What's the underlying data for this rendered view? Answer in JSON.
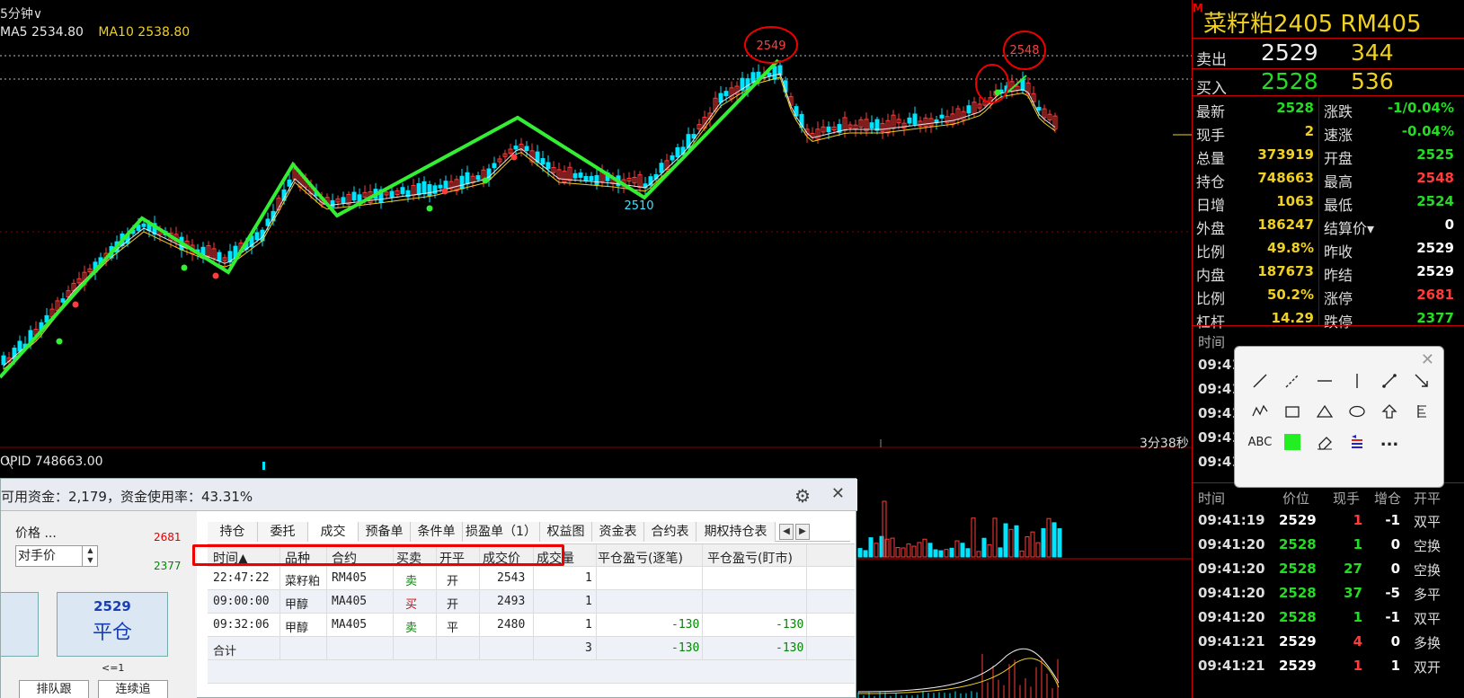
{
  "chart": {
    "period": "5分钟∨",
    "ma5_label": "MA5 2534.80",
    "ma10_label": "MA10 2538.80",
    "timer": "3分38秒",
    "opid_label": "OPID 748663.00",
    "annotations": {
      "peak1": "2549",
      "peak2": "2548",
      "trough": "2510"
    },
    "colors": {
      "up": "#ff3b3b",
      "down": "#00e5ff",
      "trend": "#33ee33",
      "ma5": "#e8e8e8",
      "ma10": "#f0d020"
    }
  },
  "quote": {
    "m_badge": "M",
    "title": "菜籽粕2405  RM405",
    "ask": {
      "label": "卖出",
      "price": "2529",
      "volume": "344"
    },
    "bid": {
      "label": "买入",
      "price": "2528",
      "volume": "536"
    },
    "stats": [
      {
        "l1": "最新",
        "v1": "2528",
        "c1": "#22dd22",
        "l2": "涨跌",
        "v2": "-1/0.04%",
        "c2": "#22dd22"
      },
      {
        "l1": "现手",
        "v1": "2",
        "c1": "#f0d020",
        "l2": "速涨",
        "v2": "-0.04%",
        "c2": "#22dd22"
      },
      {
        "l1": "总量",
        "v1": "373919",
        "c1": "#f0d020",
        "l2": "开盘",
        "v2": "2525",
        "c2": "#22dd22"
      },
      {
        "l1": "持仓",
        "v1": "748663",
        "c1": "#f0d020",
        "l2": "最高",
        "v2": "2548",
        "c2": "#ff3b3b"
      },
      {
        "l1": "日增",
        "v1": "1063",
        "c1": "#f0d020",
        "l2": "最低",
        "v2": "2524",
        "c2": "#22dd22"
      },
      {
        "l1": "外盘",
        "v1": "186247",
        "c1": "#f0d020",
        "l2": "结算价▾",
        "v2": "0",
        "c2": "#ffffff"
      },
      {
        "l1": "比例",
        "v1": "49.8%",
        "c1": "#f0d020",
        "l2": "昨收",
        "v2": "2529",
        "c2": "#ffffff"
      },
      {
        "l1": "内盘",
        "v1": "187673",
        "c1": "#f0d020",
        "l2": "昨结",
        "v2": "2529",
        "c2": "#ffffff"
      },
      {
        "l1": "比例",
        "v1": "50.2%",
        "c1": "#f0d020",
        "l2": "涨停",
        "v2": "2681",
        "c2": "#ff3b3b"
      },
      {
        "l1": "杠杆",
        "v1": "14.29",
        "c1": "#f0d020",
        "l2": "跌停",
        "v2": "2377",
        "c2": "#22dd22"
      }
    ],
    "tape_headers": [
      "时间",
      "价位",
      "现手",
      "增仓",
      "开平"
    ],
    "tape_top": [
      {
        "time": "时间"
      },
      {
        "time": "09:41"
      },
      {
        "time": "09:41"
      },
      {
        "time": "09:41"
      },
      {
        "time": "09:41"
      },
      {
        "time": "09:41"
      }
    ],
    "tape": [
      {
        "time": "09:41:19",
        "px": "2529",
        "pc": "#ffffff",
        "qty": "1",
        "inc": "-1",
        "type": "双平"
      },
      {
        "time": "09:41:20",
        "px": "2528",
        "pc": "#22dd22",
        "qty": "1",
        "inc": "0",
        "type": "空换"
      },
      {
        "time": "09:41:20",
        "px": "2528",
        "pc": "#22dd22",
        "qty": "27",
        "inc": "0",
        "type": "空换"
      },
      {
        "time": "09:41:20",
        "px": "2528",
        "pc": "#22dd22",
        "qty": "37",
        "inc": "-5",
        "type": "多平"
      },
      {
        "time": "09:41:20",
        "px": "2528",
        "pc": "#22dd22",
        "qty": "1",
        "inc": "-1",
        "type": "双平"
      },
      {
        "time": "09:41:21",
        "px": "2529",
        "pc": "#ffffff",
        "qty": "4",
        "inc": "0",
        "type": "多换"
      },
      {
        "time": "09:41:21",
        "px": "2529",
        "pc": "#ffffff",
        "qty": "1",
        "inc": "1",
        "type": "双开"
      }
    ]
  },
  "draw_tools": {
    "close": "✕",
    "icons": [
      "line-icon",
      "ray-icon",
      "hline-icon",
      "vline-icon",
      "segment-icon",
      "arrow-icon",
      "polyline-icon",
      "rect-icon",
      "triangle-icon",
      "ellipse-icon",
      "up-arrow-icon",
      "fib-icon",
      "text-icon",
      "color-icon",
      "eraser-icon",
      "settings-icon",
      "more-icon"
    ],
    "text_tool": "ABC",
    "more": "...",
    "swatch_color": "#22ee22"
  },
  "trade": {
    "funds": "可用资金：2,179，资金使用率：43.31%",
    "price_label": "价格 ...",
    "price_mode": "对手价",
    "limit_up": "2681",
    "limit_down": "2377",
    "close_price": "2529",
    "close_label": "平仓",
    "qty_hint": "<=1",
    "queue_btn": "排队跟",
    "chase_btn": "连续追",
    "tabs": [
      "持仓",
      "委托",
      "成交",
      "预备单",
      "条件单",
      "损盈单（1）",
      "权益图",
      "资金表",
      "合约表",
      "期权持仓表"
    ],
    "active_tab": 2,
    "columns": [
      "时间▲",
      "品种",
      "合约",
      "买卖",
      "开平",
      "成交价",
      "成交量",
      "平仓盈亏(逐笔)",
      "平仓盈亏(盯市)"
    ],
    "rows": [
      {
        "time": "22:47:22",
        "name": "菜籽粕",
        "code": "RM405",
        "side": "卖",
        "side_cls": "c-sell",
        "oc": "开",
        "price": "2543",
        "qty": "1",
        "pl1": "",
        "pl2": ""
      },
      {
        "time": "09:00:00",
        "name": "甲醇",
        "code": "MA405",
        "side": "买",
        "side_cls": "c-buy",
        "oc": "开",
        "price": "2493",
        "qty": "1",
        "pl1": "",
        "pl2": ""
      },
      {
        "time": "09:32:06",
        "name": "甲醇",
        "code": "MA405",
        "side": "卖",
        "side_cls": "c-sell",
        "oc": "平",
        "price": "2480",
        "qty": "1",
        "pl1": "-130",
        "pl2": "-130"
      },
      {
        "time": "合计",
        "name": "",
        "code": "",
        "side": "",
        "side_cls": "",
        "oc": "",
        "price": "",
        "qty": "3",
        "pl1": "-130",
        "pl2": "-130"
      }
    ]
  }
}
